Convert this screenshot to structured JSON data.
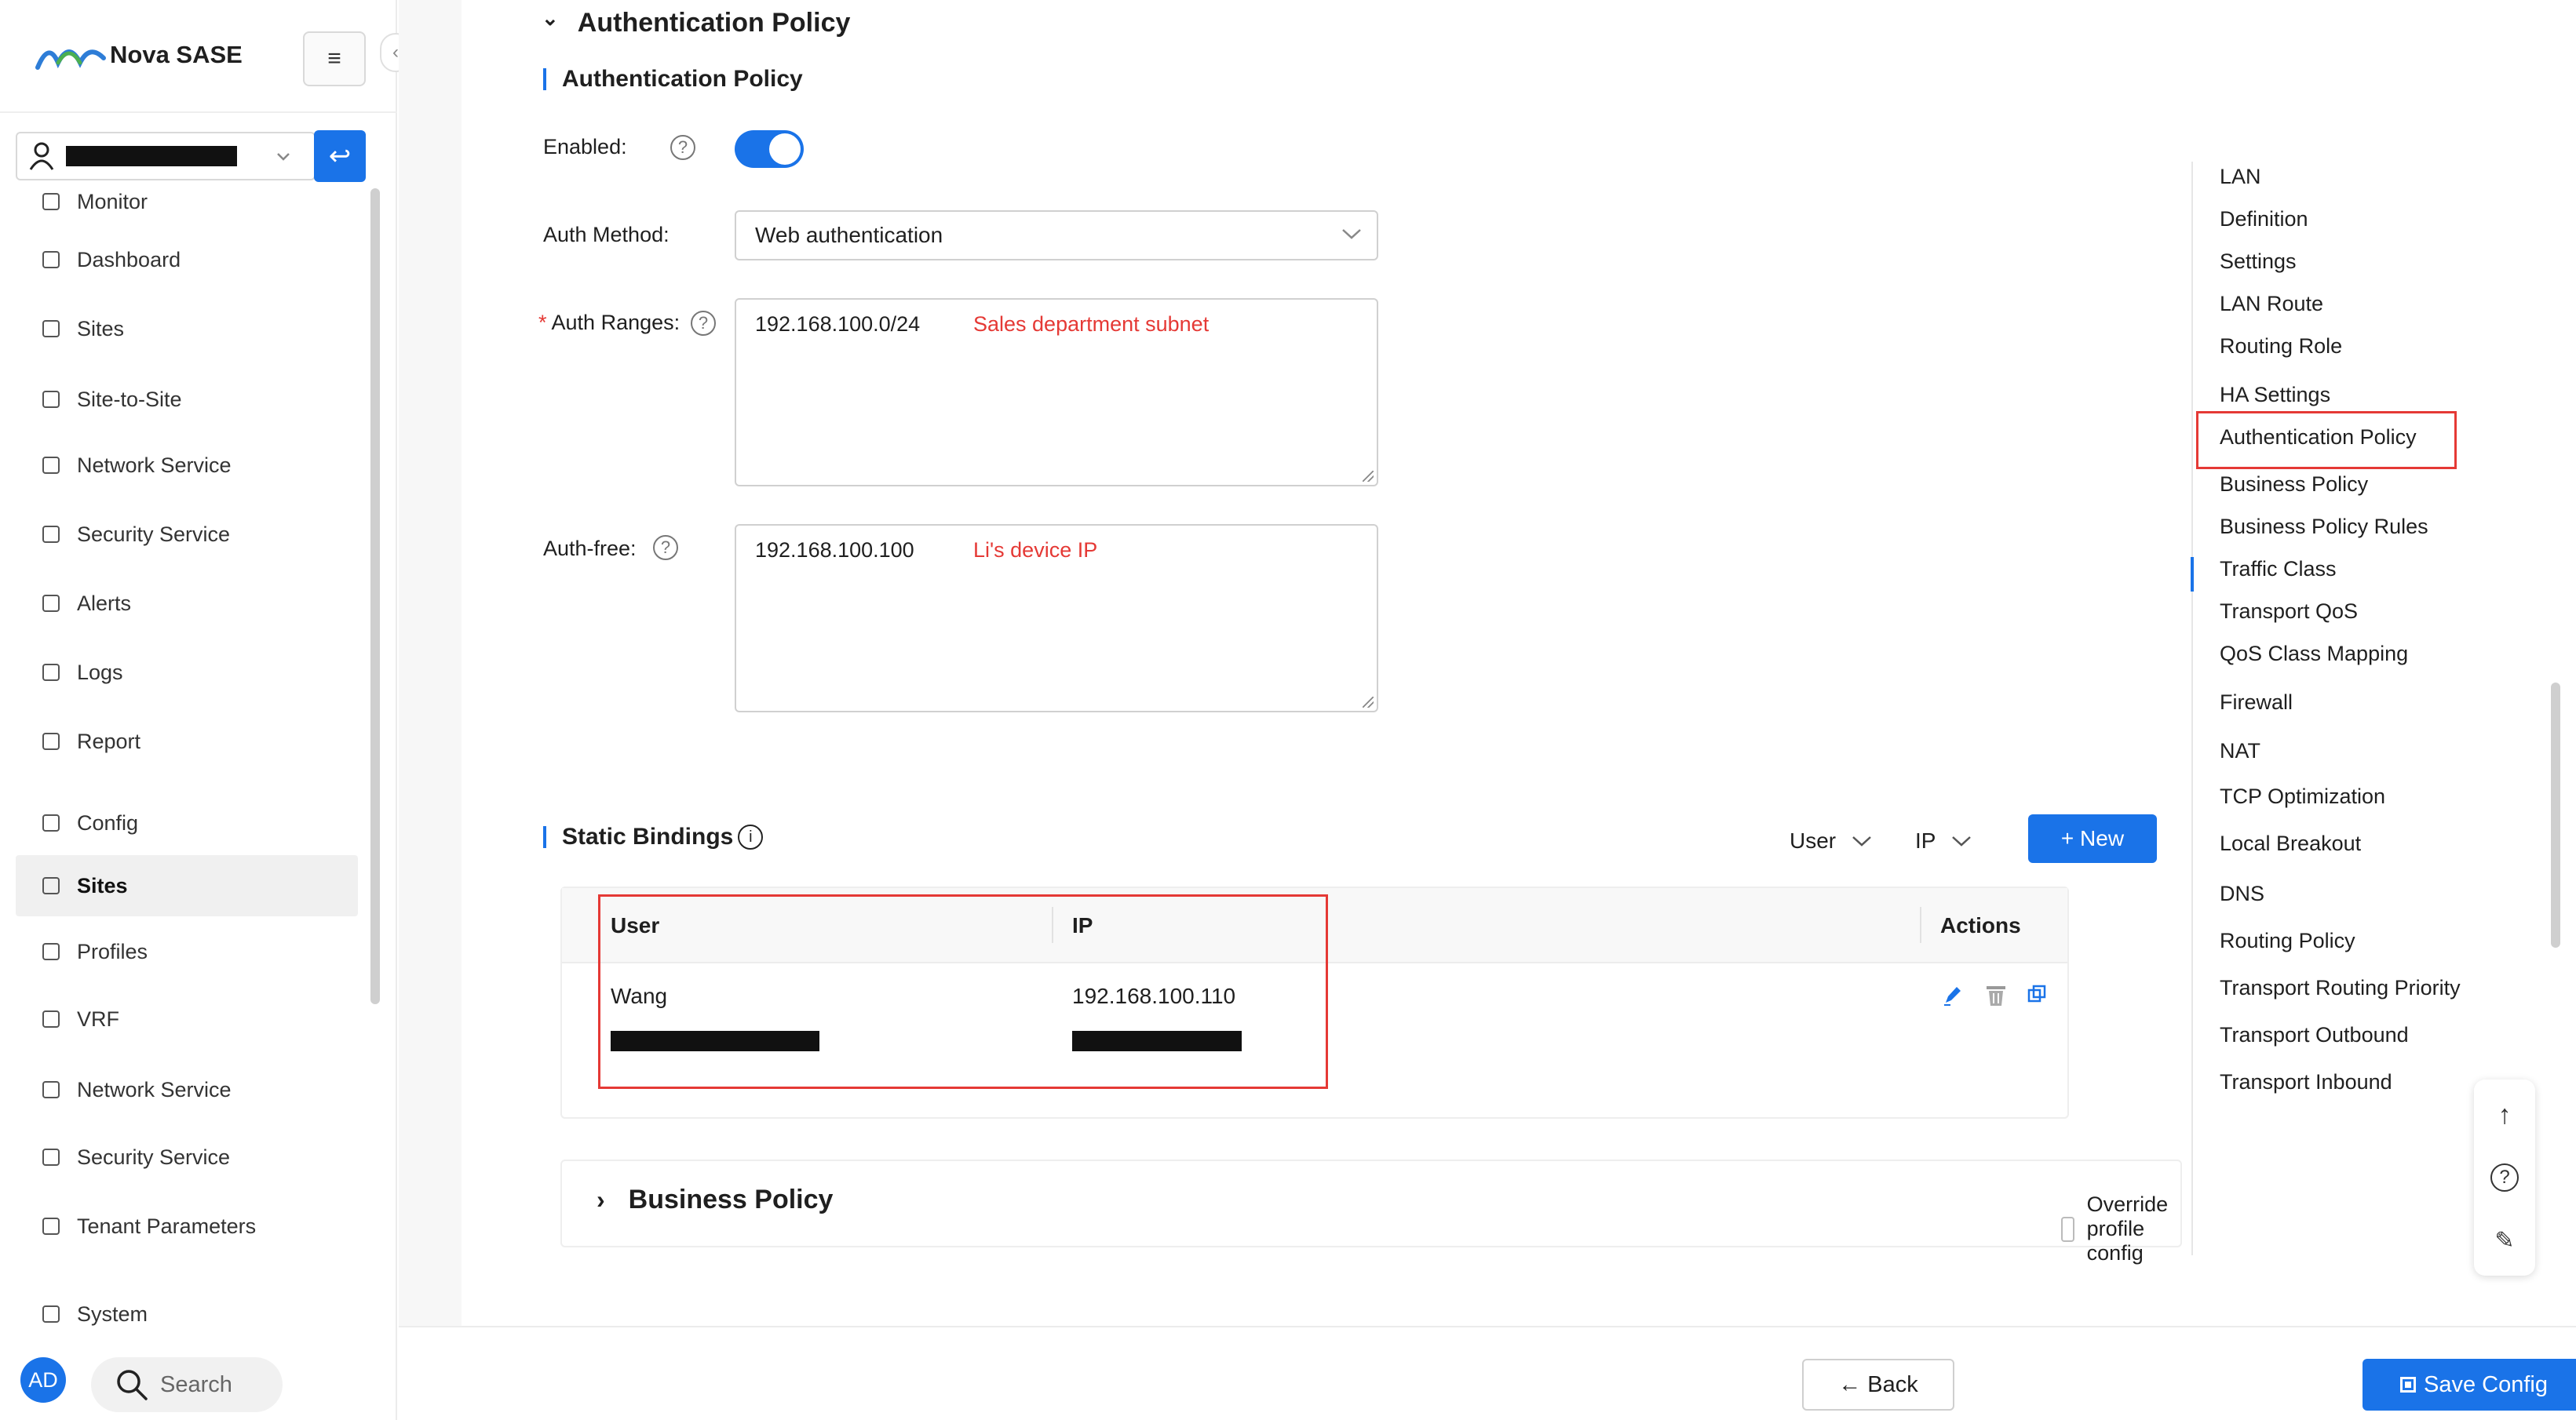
{
  "app": {
    "title": "Nova SASE",
    "collapse_glyph": "‹",
    "menu_glyph": "≡"
  },
  "sidebar": {
    "go_glyph": "↩",
    "items": [
      {
        "label": "Monitor"
      },
      {
        "label": "Dashboard"
      },
      {
        "label": "Sites"
      },
      {
        "label": "Site-to-Site"
      },
      {
        "label": "Network Service"
      },
      {
        "label": "Security Service"
      },
      {
        "label": "Alerts"
      },
      {
        "label": "Logs"
      },
      {
        "label": "Report"
      },
      {
        "label": "Config"
      },
      {
        "label": "Sites",
        "active": true
      },
      {
        "label": "Profiles"
      },
      {
        "label": "VRF"
      },
      {
        "label": "Network Service"
      },
      {
        "label": "Security Service"
      },
      {
        "label": "Tenant Parameters"
      },
      {
        "label": "System"
      }
    ],
    "avatar": "AD",
    "search_label": "Search"
  },
  "auth_policy": {
    "collapse_glyph": "⌄",
    "title": "Authentication Policy",
    "sub_title": "Authentication Policy",
    "enabled_label": "Enabled:",
    "enabled": true,
    "help_glyph": "?",
    "auth_method_label": "Auth Method:",
    "auth_method_value": "Web authentication",
    "auth_ranges_required": "*",
    "auth_ranges_label": "Auth Ranges:",
    "auth_ranges_value": "192.168.100.0/24",
    "auth_ranges_note": "Sales department subnet",
    "auth_free_label": "Auth-free:",
    "auth_free_value": "192.168.100.100",
    "auth_free_note": "Li's device IP"
  },
  "static_bindings": {
    "title": "Static Bindings",
    "info_glyph": "i",
    "filter_user": "User",
    "filter_ip": "IP",
    "new_button": "+ New",
    "columns": [
      "User",
      "IP",
      "Actions"
    ],
    "rows": [
      {
        "user": "Wang",
        "ip": "192.168.100.110"
      }
    ]
  },
  "business_policy": {
    "expand_glyph": "›",
    "title": "Business Policy",
    "override_label": "Override profile config"
  },
  "anchors": [
    "LAN",
    "Definition",
    "Settings",
    "LAN Route",
    "Routing Role",
    "HA Settings",
    "Authentication Policy",
    "Business Policy",
    "Business Policy Rules",
    "Traffic Class",
    "Transport QoS",
    "QoS Class Mapping",
    "Firewall",
    "NAT",
    "TCP Optimization",
    "Local Breakout",
    "DNS",
    "Routing Policy",
    "Transport Routing Priority",
    "Transport Outbound",
    "Transport Inbound"
  ],
  "float_tools": {
    "up_glyph": "↑",
    "help_glyph": "?",
    "edit_glyph": "✎"
  },
  "footer": {
    "back_label": "← Back",
    "save_label": "Save Config"
  },
  "colors": {
    "accent": "#1a73e8",
    "highlight": "#e53935",
    "note": "#e53935"
  }
}
